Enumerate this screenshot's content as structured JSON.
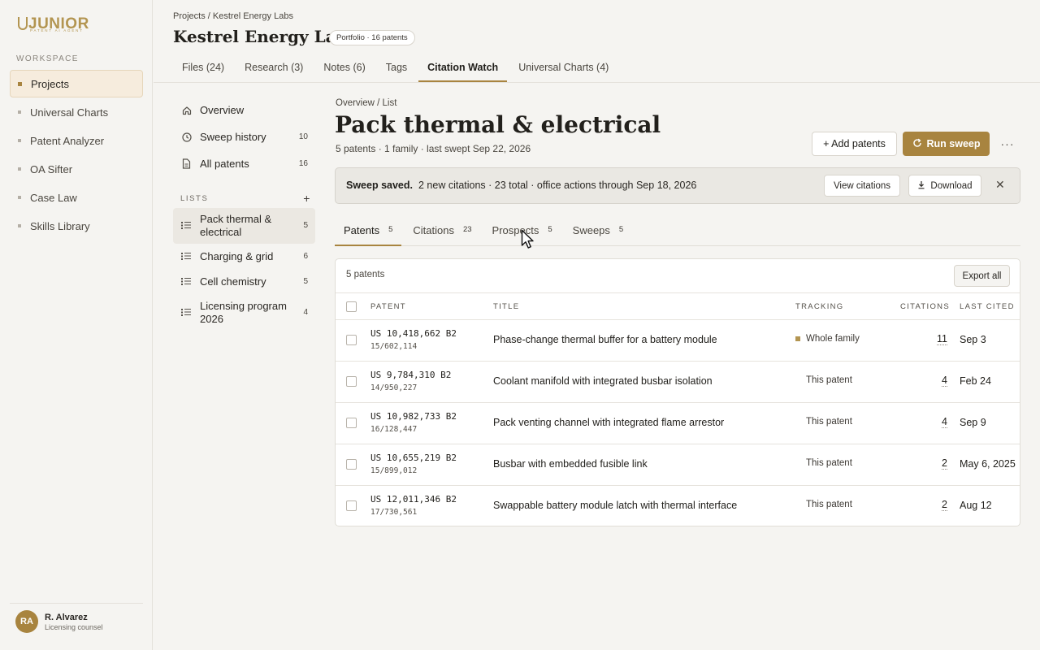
{
  "brand": {
    "name": "JUNIOR",
    "tagline": "PATENT AI AGENT"
  },
  "sidebar": {
    "section_label": "WORKSPACE",
    "items": [
      {
        "label": "Projects"
      },
      {
        "label": "Universal Charts"
      },
      {
        "label": "Patent Analyzer"
      },
      {
        "label": "OA Sifter"
      },
      {
        "label": "Case Law"
      },
      {
        "label": "Skills Library"
      }
    ],
    "user": {
      "initials": "RA",
      "name": "R. Alvarez",
      "role": "Licensing counsel"
    }
  },
  "header": {
    "breadcrumb": "Projects / Kestrel Energy Labs",
    "title": "Kestrel Energy Labs",
    "badge": "Portfolio · 16 patents",
    "tabs": [
      {
        "label": "Files (24)"
      },
      {
        "label": "Research (3)"
      },
      {
        "label": "Notes (6)"
      },
      {
        "label": "Tags"
      },
      {
        "label": "Citation Watch"
      },
      {
        "label": "Universal Charts (4)"
      }
    ]
  },
  "panel": {
    "top_items": [
      {
        "label": "Overview",
        "count": ""
      },
      {
        "label": "Sweep history",
        "count": "10"
      },
      {
        "label": "All patents",
        "count": "16"
      }
    ],
    "lists_label": "LISTS",
    "add_symbol": "+",
    "lists": [
      {
        "label": "Pack thermal & electrical",
        "count": "5"
      },
      {
        "label": "Charging & grid",
        "count": "6"
      },
      {
        "label": "Cell chemistry",
        "count": "5"
      },
      {
        "label": "Licensing program 2026",
        "count": "4"
      }
    ]
  },
  "main": {
    "breadcrumb": "Overview / List",
    "title": "Pack thermal & electrical",
    "meta": "5 patents · 1 family · last swept Sep 22, 2026",
    "add_button": "+ Add patents",
    "run_button": "Run sweep",
    "more_symbol": "···",
    "banner": {
      "strong": "Sweep saved.",
      "text": "2 new citations · 23 total · office actions through Sep 18, 2026",
      "view_button": "View citations",
      "download_button": "Download",
      "close_symbol": "✕"
    },
    "subtabs": [
      {
        "label": "Patents",
        "count": "5"
      },
      {
        "label": "Citations",
        "count": "23"
      },
      {
        "label": "Prospects",
        "count": "5"
      },
      {
        "label": "Sweeps",
        "count": "5"
      }
    ],
    "table": {
      "count_label": "5 patents",
      "export_button": "Export all",
      "columns": {
        "patent": "PATENT",
        "title": "TITLE",
        "tracking": "TRACKING",
        "citations": "CITATIONS",
        "last_cited": "LAST CITED"
      },
      "rows": [
        {
          "patent": "US 10,418,662 B2",
          "app": "15/602,114",
          "title": "Phase-change thermal buffer for a battery module",
          "tracking": "Whole family",
          "citations": "11",
          "last_cited": "Sep 3"
        },
        {
          "patent": "US 9,784,310 B2",
          "app": "14/950,227",
          "title": "Coolant manifold with integrated busbar isolation",
          "tracking": "This patent",
          "citations": "4",
          "last_cited": "Feb 24"
        },
        {
          "patent": "US 10,982,733 B2",
          "app": "16/128,447",
          "title": "Pack venting channel with integrated flame arrestor",
          "tracking": "This patent",
          "citations": "4",
          "last_cited": "Sep 9"
        },
        {
          "patent": "US 10,655,219 B2",
          "app": "15/899,012",
          "title": "Busbar with embedded fusible link",
          "tracking": "This patent",
          "citations": "2",
          "last_cited": "May 6, 2025"
        },
        {
          "patent": "US 12,011,346 B2",
          "app": "17/730,561",
          "title": "Swappable battery module latch with thermal interface",
          "tracking": "This patent",
          "citations": "2",
          "last_cited": "Aug 12"
        }
      ]
    }
  },
  "colors": {
    "accent": "#a8843f",
    "brand": "#b39551",
    "background": "#f5f4f1"
  }
}
